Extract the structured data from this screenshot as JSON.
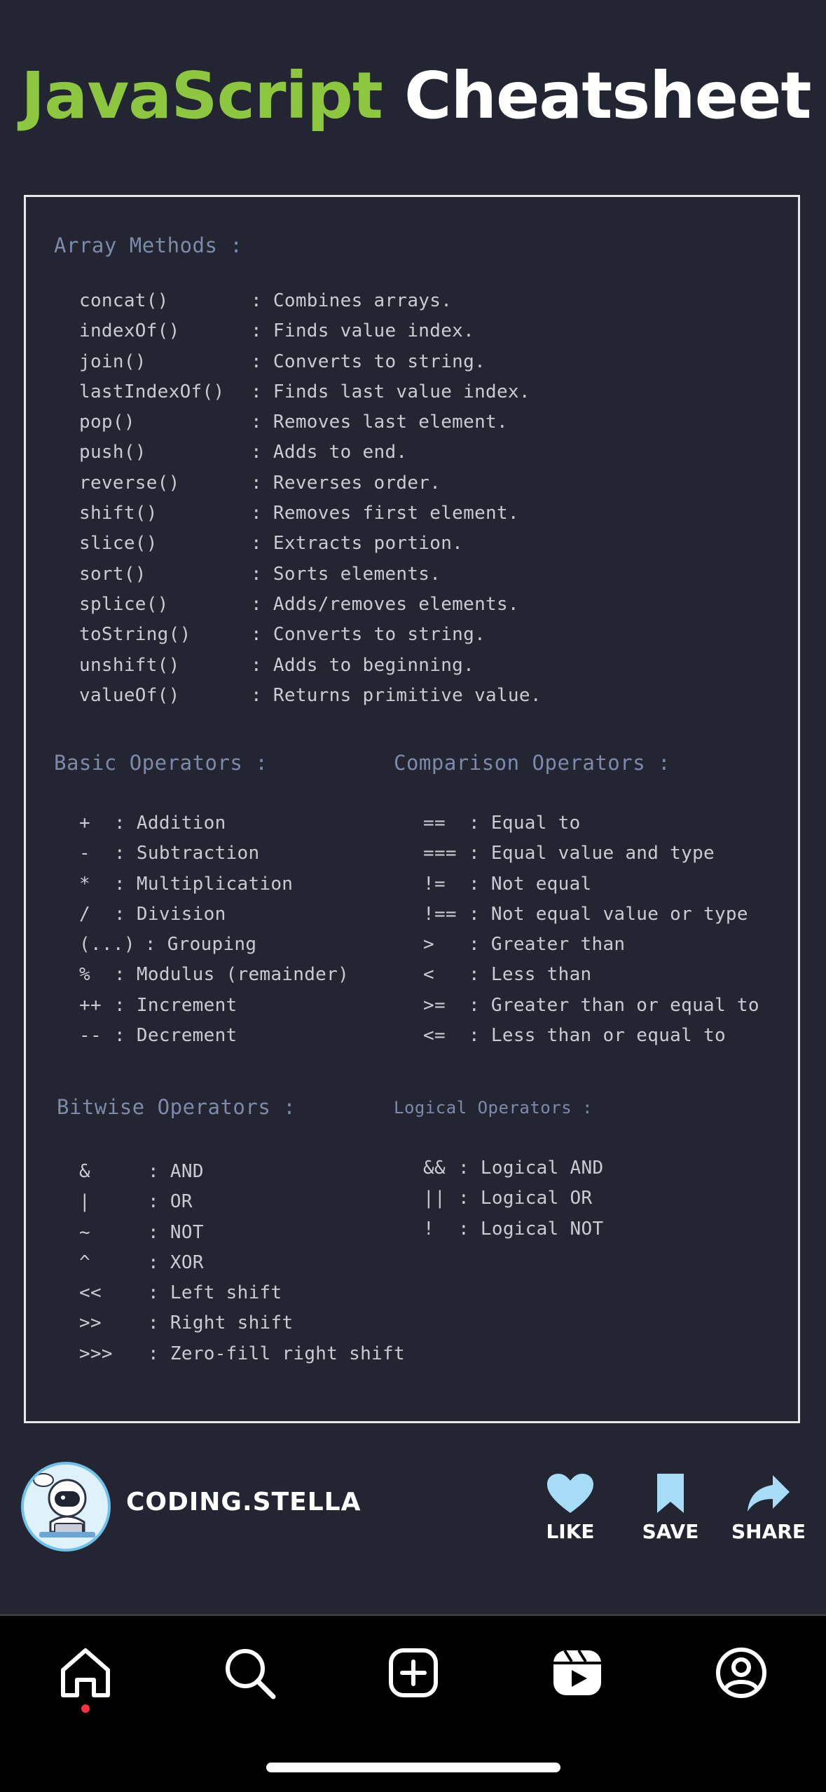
{
  "title": {
    "part1": "JavaScript",
    "part2": "Cheatsheet"
  },
  "colors": {
    "accent": "#8dc63f",
    "background": "#242532",
    "heading": "#7e8aa8",
    "text": "#c9cbd3",
    "like": "#a6dcf5"
  },
  "array": {
    "heading": "Array Methods :",
    "items": [
      {
        "m": "concat()",
        "d": ": Combines arrays."
      },
      {
        "m": "indexOf()",
        "d": ": Finds value index."
      },
      {
        "m": "join()",
        "d": ": Converts to string."
      },
      {
        "m": "lastIndexOf()",
        "d": ": Finds last value index."
      },
      {
        "m": "pop()",
        "d": ": Removes last element."
      },
      {
        "m": "push()",
        "d": ": Adds to end."
      },
      {
        "m": "reverse()",
        "d": ": Reverses order."
      },
      {
        "m": "shift()",
        "d": ": Removes first element."
      },
      {
        "m": "slice()",
        "d": ": Extracts portion."
      },
      {
        "m": "sort()",
        "d": ": Sorts elements."
      },
      {
        "m": "splice()",
        "d": ": Adds/removes elements."
      },
      {
        "m": "toString()",
        "d": ": Converts to string."
      },
      {
        "m": "unshift()",
        "d": ": Adds to beginning."
      },
      {
        "m": "valueOf()",
        "d": ": Returns primitive value."
      }
    ]
  },
  "basic": {
    "heading": "Basic Operators :",
    "items": [
      {
        "op": "+",
        "d": ": Addition"
      },
      {
        "op": "-",
        "d": ": Subtraction"
      },
      {
        "op": "*",
        "d": ": Multiplication"
      },
      {
        "op": "/",
        "d": ": Division"
      },
      {
        "op": "(...)",
        "d": ": Grouping"
      },
      {
        "op": "%",
        "d": ": Modulus (remainder)"
      },
      {
        "op": "++",
        "d": ": Increment"
      },
      {
        "op": "--",
        "d": ": Decrement"
      }
    ]
  },
  "comparison": {
    "heading": "Comparison Operators :",
    "items": [
      {
        "op": "==",
        "d": ": Equal to"
      },
      {
        "op": "===",
        "d": ": Equal value and type"
      },
      {
        "op": "!=",
        "d": ": Not equal"
      },
      {
        "op": "!==",
        "d": ": Not equal value or type"
      },
      {
        "op": ">",
        "d": ": Greater than"
      },
      {
        "op": "<",
        "d": ": Less than"
      },
      {
        "op": ">=",
        "d": ": Greater than or equal to"
      },
      {
        "op": "<=",
        "d": ": Less than or equal to"
      }
    ]
  },
  "bitwise": {
    "heading": "Bitwise Operators :",
    "items": [
      {
        "op": "&",
        "d": ": AND"
      },
      {
        "op": "|",
        "d": ": OR"
      },
      {
        "op": "~",
        "d": ": NOT"
      },
      {
        "op": "^",
        "d": ": XOR"
      },
      {
        "op": "<<",
        "d": ": Left shift"
      },
      {
        "op": ">>",
        "d": ": Right shift"
      },
      {
        "op": ">>>",
        "d": ": Zero-fill right shift"
      }
    ]
  },
  "logical": {
    "heading": "Logical Operators :",
    "items": [
      {
        "op": "&&",
        "d": ": Logical AND"
      },
      {
        "op": "||",
        "d": ": Logical OR"
      },
      {
        "op": "!",
        "d": ": Logical NOT"
      }
    ]
  },
  "post": {
    "username": "CODING.STELLA",
    "like_label": "LIKE",
    "save_label": "SAVE",
    "share_label": "SHARE"
  },
  "nav": {
    "items": [
      "home-icon",
      "search-icon",
      "create-icon",
      "reels-icon",
      "profile-icon"
    ],
    "active": "home-icon"
  }
}
